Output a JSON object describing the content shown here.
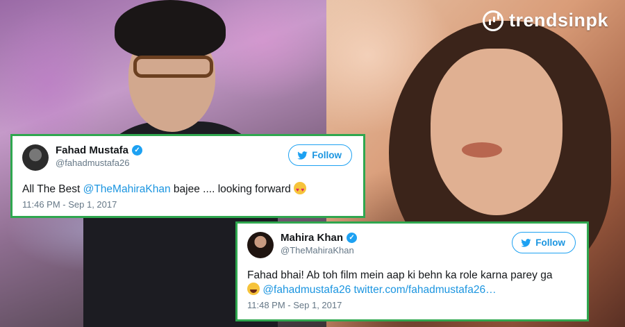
{
  "brand": {
    "logo_text": "trendsinpk"
  },
  "tweets": [
    {
      "name": "Fahad Mustafa",
      "handle": "@fahadmustafa26",
      "follow_label": "Follow",
      "text_before": "All The Best ",
      "mention": "@TheMahiraKhan",
      "text_after": " bajee .... looking forward ",
      "timestamp": "11:46 PM - Sep 1, 2017",
      "emoji": "heart-eyes-emoji"
    },
    {
      "name": "Mahira Khan",
      "handle": "@TheMahiraKhan",
      "follow_label": "Follow",
      "text_line1": "Fahad bhai! Ab toh film mein aap ki behn ka role karna parey ga",
      "mention": "@fahadmustafa26",
      "link": "twitter.com/fahadmustafa26…",
      "timestamp": "11:48 PM - Sep 1, 2017",
      "emoji": "tears-of-joy-emoji"
    }
  ],
  "colors": {
    "border": "#2fa74f",
    "twitter_blue": "#1da1f2",
    "link": "#1b95e0"
  }
}
